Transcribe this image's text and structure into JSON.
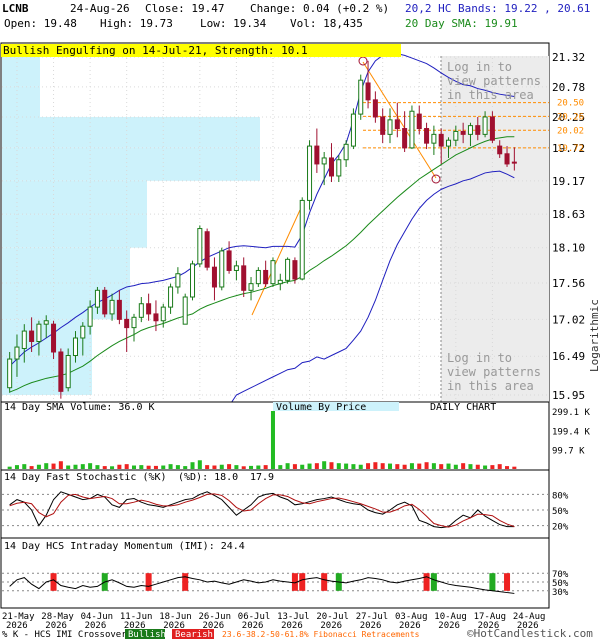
{
  "header": {
    "ticker": "LCNB",
    "date": "24-Aug-26",
    "close": "Close: 19.47",
    "change": "Change: 0.04 (+0.2 %)",
    "open": "Open: 19.48",
    "high": "High: 19.73",
    "low": "Low: 19.34",
    "vol": "Vol: 18,435",
    "bands_label": "20,2 HC Bands: 19.22 , 20.61",
    "sma_label": "20 Day SMA: 19.91"
  },
  "banner": "Bullish Engulfing on 14-Jul-21, Strength: 10.1",
  "watermark": [
    "Log in to",
    "view patterns",
    "in this area"
  ],
  "price_axis": {
    "ticks": [
      "21.32",
      "20.78",
      "20.25",
      "19.72",
      "19.17",
      "18.63",
      "18.10",
      "17.56",
      "17.02",
      "16.49",
      "15.95"
    ],
    "fib_labels": [
      "20.50",
      "20.26",
      "20.02",
      "19.72"
    ],
    "scale_label": "Logarithmic"
  },
  "volume_panel": {
    "title": "14 Day SMA Volume: 36.0 K",
    "vbp_label": "Volume By Price",
    "chart_label": "DAILY CHART",
    "ticks": [
      "299.1 K",
      "199.4 K",
      "99.7 K"
    ]
  },
  "stoch_panel": {
    "title": "14 Day Fast Stochastic (%K)",
    "d_label": "(%D): 18.0",
    "d_value": "17.9",
    "ticks": [
      "80%",
      "50%",
      "20%"
    ]
  },
  "imi_panel": {
    "title": "14 Day HCS Intraday Momentum (IMI): 24.4",
    "ticks": [
      "70%",
      "50%",
      "30%"
    ]
  },
  "x_axis": {
    "dates": [
      "21-May",
      "28-May",
      "04-Jun",
      "11-Jun",
      "18-Jun",
      "26-Jun",
      "06-Jul",
      "13-Jul",
      "20-Jul",
      "27-Jul",
      "03-Aug",
      "10-Aug",
      "17-Aug",
      "24-Aug"
    ],
    "year": "2026"
  },
  "footer": {
    "crossover": "% K - HCS IMI Crossover,",
    "bullish": "Bullish",
    "bearish": "Bearish",
    "fib": "23.6-38.2-50-61.8% Fibonacci Retracements",
    "credit": "©HotCandlestick.com"
  },
  "colors": {
    "up": "#1a7a1a",
    "down": "#a01030",
    "upper_band": "#1f1fbf",
    "sma": "#1a8a1a",
    "banner": "#ffff00",
    "vbp": "#cdf2fb",
    "vol_up": "#22bb22",
    "vol_down": "#ee2222",
    "fib": "#ff8c00"
  },
  "chart_data": {
    "type": "candlestick",
    "scale": "log",
    "ylim": [
      15.95,
      21.32
    ],
    "bars": [
      {
        "o": 16.05,
        "h": 16.55,
        "l": 15.98,
        "c": 16.45
      },
      {
        "o": 16.45,
        "h": 16.8,
        "l": 16.2,
        "c": 16.62
      },
      {
        "o": 16.6,
        "h": 16.95,
        "l": 16.4,
        "c": 16.85
      },
      {
        "o": 16.85,
        "h": 17.05,
        "l": 16.55,
        "c": 16.7
      },
      {
        "o": 16.7,
        "h": 17.0,
        "l": 16.5,
        "c": 16.95
      },
      {
        "o": 16.95,
        "h": 17.08,
        "l": 16.75,
        "c": 17.0
      },
      {
        "o": 16.95,
        "h": 17.0,
        "l": 16.45,
        "c": 16.55
      },
      {
        "o": 16.55,
        "h": 16.6,
        "l": 15.9,
        "c": 16.0
      },
      {
        "o": 16.05,
        "h": 16.6,
        "l": 16.0,
        "c": 16.5
      },
      {
        "o": 16.5,
        "h": 16.85,
        "l": 16.4,
        "c": 16.75
      },
      {
        "o": 16.75,
        "h": 16.98,
        "l": 16.5,
        "c": 16.92
      },
      {
        "o": 16.92,
        "h": 17.3,
        "l": 16.8,
        "c": 17.2
      },
      {
        "o": 17.2,
        "h": 17.5,
        "l": 17.1,
        "c": 17.45
      },
      {
        "o": 17.45,
        "h": 17.5,
        "l": 17.05,
        "c": 17.1
      },
      {
        "o": 17.1,
        "h": 17.4,
        "l": 17.0,
        "c": 17.3
      },
      {
        "o": 17.3,
        "h": 17.45,
        "l": 16.95,
        "c": 17.02
      },
      {
        "o": 17.02,
        "h": 17.15,
        "l": 16.55,
        "c": 16.9
      },
      {
        "o": 16.9,
        "h": 17.1,
        "l": 16.7,
        "c": 17.05
      },
      {
        "o": 17.05,
        "h": 17.35,
        "l": 16.98,
        "c": 17.25
      },
      {
        "o": 17.25,
        "h": 17.4,
        "l": 17.0,
        "c": 17.1
      },
      {
        "o": 17.1,
        "h": 17.3,
        "l": 16.85,
        "c": 17.0
      },
      {
        "o": 17.0,
        "h": 17.25,
        "l": 16.9,
        "c": 17.2
      },
      {
        "o": 17.2,
        "h": 17.55,
        "l": 17.1,
        "c": 17.5
      },
      {
        "o": 17.5,
        "h": 17.8,
        "l": 17.4,
        "c": 17.7
      },
      {
        "o": 16.95,
        "h": 17.4,
        "l": 16.95,
        "c": 17.35
      },
      {
        "o": 17.35,
        "h": 17.9,
        "l": 17.3,
        "c": 17.85
      },
      {
        "o": 17.85,
        "h": 18.45,
        "l": 17.8,
        "c": 18.4
      },
      {
        "o": 18.35,
        "h": 18.4,
        "l": 17.75,
        "c": 17.8
      },
      {
        "o": 17.8,
        "h": 17.95,
        "l": 17.3,
        "c": 17.5
      },
      {
        "o": 17.5,
        "h": 18.1,
        "l": 17.45,
        "c": 18.05
      },
      {
        "o": 18.05,
        "h": 18.2,
        "l": 17.7,
        "c": 17.75
      },
      {
        "o": 17.75,
        "h": 17.9,
        "l": 17.6,
        "c": 17.82
      },
      {
        "o": 17.82,
        "h": 17.95,
        "l": 17.35,
        "c": 17.45
      },
      {
        "o": 17.45,
        "h": 17.65,
        "l": 17.3,
        "c": 17.55
      },
      {
        "o": 17.55,
        "h": 17.8,
        "l": 17.5,
        "c": 17.75
      },
      {
        "o": 17.75,
        "h": 17.9,
        "l": 17.5,
        "c": 17.55
      },
      {
        "o": 17.55,
        "h": 17.95,
        "l": 17.5,
        "c": 17.9
      },
      {
        "o": 17.55,
        "h": 17.7,
        "l": 17.45,
        "c": 17.6
      },
      {
        "o": 17.6,
        "h": 17.95,
        "l": 17.55,
        "c": 17.92
      },
      {
        "o": 17.9,
        "h": 17.95,
        "l": 17.55,
        "c": 17.62
      },
      {
        "o": 17.62,
        "h": 18.9,
        "l": 17.6,
        "c": 18.85
      },
      {
        "o": 18.85,
        "h": 19.85,
        "l": 18.7,
        "c": 19.75
      },
      {
        "o": 19.75,
        "h": 20.05,
        "l": 19.3,
        "c": 19.45
      },
      {
        "o": 19.45,
        "h": 19.65,
        "l": 19.1,
        "c": 19.55
      },
      {
        "o": 19.55,
        "h": 19.8,
        "l": 19.15,
        "c": 19.25
      },
      {
        "o": 19.25,
        "h": 19.6,
        "l": 19.15,
        "c": 19.52
      },
      {
        "o": 19.52,
        "h": 19.85,
        "l": 19.4,
        "c": 19.78
      },
      {
        "o": 19.75,
        "h": 20.4,
        "l": 19.7,
        "c": 20.3
      },
      {
        "o": 20.3,
        "h": 21.0,
        "l": 20.2,
        "c": 20.9
      },
      {
        "o": 20.85,
        "h": 21.25,
        "l": 20.4,
        "c": 20.55
      },
      {
        "o": 20.55,
        "h": 20.7,
        "l": 20.15,
        "c": 20.25
      },
      {
        "o": 20.25,
        "h": 20.4,
        "l": 19.8,
        "c": 19.95
      },
      {
        "o": 19.95,
        "h": 20.4,
        "l": 19.8,
        "c": 20.2
      },
      {
        "o": 20.2,
        "h": 20.5,
        "l": 19.9,
        "c": 20.05
      },
      {
        "o": 20.05,
        "h": 20.35,
        "l": 19.65,
        "c": 19.72
      },
      {
        "o": 19.72,
        "h": 20.45,
        "l": 19.7,
        "c": 20.35
      },
      {
        "o": 20.3,
        "h": 20.45,
        "l": 19.95,
        "c": 20.05
      },
      {
        "o": 20.05,
        "h": 20.15,
        "l": 19.7,
        "c": 19.8
      },
      {
        "o": 19.8,
        "h": 20.1,
        "l": 19.6,
        "c": 19.95
      },
      {
        "o": 19.95,
        "h": 20.05,
        "l": 19.45,
        "c": 19.75
      },
      {
        "o": 19.75,
        "h": 19.9,
        "l": 19.55,
        "c": 19.85
      },
      {
        "o": 19.85,
        "h": 20.1,
        "l": 19.75,
        "c": 20.0
      },
      {
        "o": 20.0,
        "h": 20.15,
        "l": 19.8,
        "c": 19.95
      },
      {
        "o": 19.95,
        "h": 20.15,
        "l": 19.75,
        "c": 20.1
      },
      {
        "o": 20.1,
        "h": 20.25,
        "l": 19.85,
        "c": 19.95
      },
      {
        "o": 19.95,
        "h": 20.35,
        "l": 19.9,
        "c": 20.25
      },
      {
        "o": 20.25,
        "h": 20.35,
        "l": 19.8,
        "c": 19.85
      },
      {
        "o": 19.75,
        "h": 19.85,
        "l": 19.55,
        "c": 19.62
      },
      {
        "o": 19.62,
        "h": 19.75,
        "l": 19.4,
        "c": 19.45
      },
      {
        "o": 19.48,
        "h": 19.73,
        "l": 19.34,
        "c": 19.47
      }
    ],
    "sma20": [
      15.99,
      16.03,
      16.08,
      16.12,
      16.15,
      16.18,
      16.2,
      16.22,
      16.25,
      16.3,
      16.35,
      16.42,
      16.5,
      16.57,
      16.64,
      16.7,
      16.75,
      16.8,
      16.86,
      16.9,
      16.93,
      16.96,
      17.0,
      17.04,
      17.07,
      17.1,
      17.17,
      17.22,
      17.26,
      17.3,
      17.34,
      17.37,
      17.4,
      17.42,
      17.45,
      17.48,
      17.52,
      17.55,
      17.58,
      17.6,
      17.66,
      17.75,
      17.82,
      17.9,
      17.97,
      18.05,
      18.13,
      18.23,
      18.34,
      18.46,
      18.57,
      18.68,
      18.79,
      18.9,
      19.0,
      19.1,
      19.2,
      19.28,
      19.36,
      19.44,
      19.52,
      19.6,
      19.66,
      19.72,
      19.78,
      19.83,
      19.87,
      19.89,
      19.91,
      19.91
    ],
    "upper_band": [
      16.35,
      16.45,
      16.55,
      16.62,
      16.68,
      16.75,
      16.82,
      16.9,
      16.97,
      17.05,
      17.12,
      17.2,
      17.27,
      17.32,
      17.38,
      17.45,
      17.5,
      17.52,
      17.55,
      17.56,
      17.58,
      17.6,
      17.63,
      17.66,
      17.72,
      17.8,
      17.88,
      17.95,
      18.0,
      18.05,
      18.1,
      18.12,
      18.13,
      18.12,
      18.11,
      18.1,
      18.12,
      18.12,
      18.12,
      18.11,
      18.3,
      18.65,
      18.95,
      19.2,
      19.45,
      19.6,
      19.8,
      20.2,
      20.7,
      21.05,
      21.25,
      21.35,
      21.38,
      21.38,
      21.35,
      21.3,
      21.25,
      21.2,
      21.12,
      21.03,
      20.95,
      20.88,
      20.82,
      20.8,
      20.75,
      20.72,
      20.68,
      20.65,
      20.63,
      20.61
    ],
    "lower_band": [
      15.8,
      15.8,
      15.8,
      15.8,
      15.8,
      15.8,
      15.8,
      15.8,
      15.8,
      15.8,
      15.8,
      15.8,
      15.8,
      15.8,
      15.8,
      15.8,
      15.8,
      15.8,
      15.8,
      15.8,
      15.8,
      15.8,
      15.8,
      15.8,
      15.8,
      15.8,
      15.8,
      15.8,
      15.8,
      15.8,
      15.8,
      15.95,
      16.0,
      16.05,
      16.1,
      16.15,
      16.2,
      16.25,
      16.3,
      16.32,
      16.4,
      16.42,
      16.48,
      16.45,
      16.5,
      16.55,
      16.6,
      16.72,
      16.85,
      17.05,
      17.3,
      17.6,
      17.9,
      18.15,
      18.35,
      18.55,
      18.72,
      18.85,
      18.95,
      19.03,
      19.08,
      19.12,
      19.17,
      19.2,
      19.25,
      19.3,
      19.32,
      19.33,
      19.28,
      19.22
    ],
    "volume": [
      12,
      20,
      25,
      15,
      22,
      30,
      28,
      40,
      18,
      22,
      25,
      30,
      20,
      15,
      14,
      22,
      25,
      18,
      20,
      17,
      16,
      18,
      25,
      20,
      15,
      35,
      45,
      20,
      18,
      22,
      25,
      20,
      14,
      16,
      18,
      20,
      299,
      20,
      30,
      25,
      22,
      28,
      30,
      40,
      35,
      30,
      28,
      25,
      22,
      30,
      35,
      30,
      28,
      25,
      22,
      30,
      28,
      35,
      30,
      25,
      28,
      22,
      30,
      25,
      22,
      18,
      20,
      25,
      15,
      12
    ],
    "stoch_k": [
      60,
      70,
      65,
      50,
      20,
      40,
      70,
      85,
      80,
      75,
      70,
      72,
      80,
      75,
      60,
      55,
      70,
      72,
      65,
      60,
      58,
      55,
      60,
      65,
      70,
      72,
      80,
      85,
      78,
      70,
      55,
      40,
      50,
      60,
      75,
      80,
      82,
      75,
      70,
      60,
      62,
      66,
      70,
      72,
      75,
      70,
      65,
      62,
      60,
      50,
      45,
      42,
      50,
      60,
      65,
      58,
      30,
      25,
      18,
      16,
      18,
      30,
      40,
      35,
      50,
      38,
      30,
      22,
      18,
      18
    ],
    "stoch_d": [
      58,
      63,
      65,
      62,
      45,
      37,
      43,
      65,
      78,
      80,
      75,
      72,
      74,
      76,
      72,
      62,
      62,
      65,
      69,
      66,
      61,
      58,
      58,
      60,
      65,
      69,
      74,
      80,
      81,
      78,
      68,
      55,
      48,
      50,
      62,
      72,
      79,
      79,
      76,
      69,
      64,
      62,
      66,
      69,
      72,
      73,
      70,
      66,
      62,
      57,
      52,
      46,
      46,
      51,
      58,
      61,
      51,
      38,
      24,
      20,
      17,
      21,
      29,
      35,
      42,
      41,
      39,
      30,
      23,
      18
    ],
    "imi": [
      40,
      55,
      60,
      45,
      35,
      50,
      55,
      42,
      38,
      35,
      42,
      38,
      40,
      50,
      55,
      48,
      40,
      38,
      42,
      40,
      45,
      50,
      55,
      60,
      62,
      58,
      55,
      50,
      52,
      48,
      45,
      50,
      55,
      52,
      48,
      50,
      55,
      52,
      50,
      48,
      55,
      58,
      60,
      55,
      52,
      50,
      48,
      52,
      55,
      60,
      58,
      55,
      50,
      48,
      52,
      55,
      58,
      62,
      55,
      50,
      45,
      42,
      40,
      38,
      35,
      32,
      30,
      28,
      26,
      24
    ]
  }
}
